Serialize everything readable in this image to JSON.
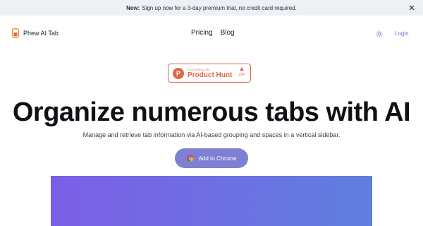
{
  "banner": {
    "label": "New:",
    "text": "Sign up now for a 3-day premium trial, no credit card required."
  },
  "nav": {
    "brand": "Phew AI Tab",
    "links": [
      "Pricing",
      "Blog"
    ],
    "login": "Login"
  },
  "product_hunt": {
    "featured": "FEATURED ON",
    "name": "Product Hunt",
    "logo_letter": "P",
    "votes": "294"
  },
  "hero": {
    "title": "Organize numerous tabs with AI",
    "subtitle": "Manage and retrieve tab information via AI-based grouping and spaces in a vertical sidebar.",
    "cta": "Add to Chrome"
  },
  "colors": {
    "accent": "#7f7fd3",
    "product_hunt": "#e2654a",
    "login": "#6b6fd6",
    "banner_bg": "#eef0f5"
  }
}
